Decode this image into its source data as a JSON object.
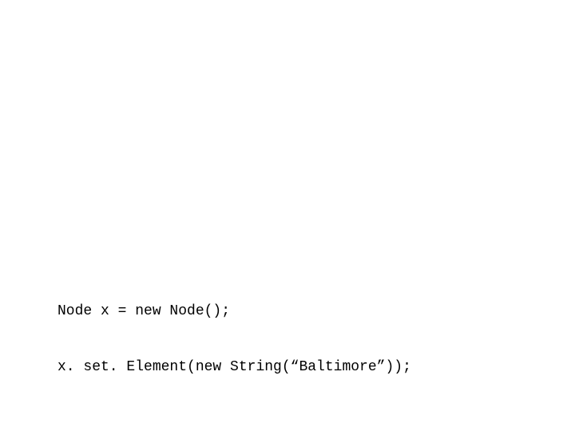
{
  "code": {
    "line1": "Node x = new Node();",
    "line2": "x. set. Element(new String(“Baltimore”));"
  }
}
